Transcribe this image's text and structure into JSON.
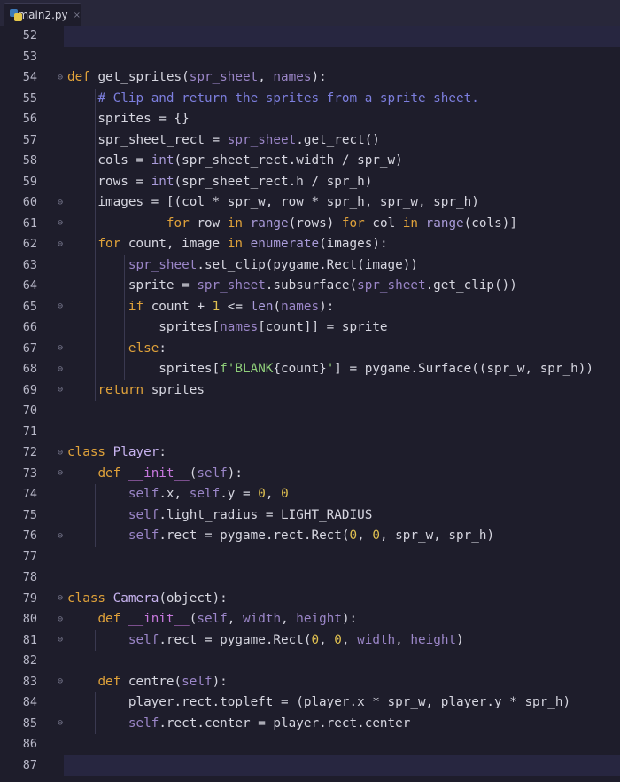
{
  "tab": {
    "filename": "main2.py",
    "close": "×"
  },
  "lines": [
    {
      "n": "52",
      "fold": "",
      "segs": []
    },
    {
      "n": "53",
      "fold": "",
      "segs": []
    },
    {
      "n": "54",
      "fold": "⊖",
      "segs": [
        [
          "kw",
          "def "
        ],
        [
          "fn",
          "get_sprites("
        ],
        [
          "pm",
          "spr_sheet"
        ],
        [
          "fn",
          ", "
        ],
        [
          "pm",
          "names"
        ],
        [
          "fn",
          "):"
        ]
      ]
    },
    {
      "n": "55",
      "fold": "",
      "segs": [
        [
          "fn",
          "    "
        ],
        [
          "cm",
          "# Clip and return the sprites from a sprite sheet."
        ]
      ]
    },
    {
      "n": "56",
      "fold": "",
      "segs": [
        [
          "fn",
          "    sprites = {}"
        ]
      ]
    },
    {
      "n": "57",
      "fold": "",
      "segs": [
        [
          "fn",
          "    spr_sheet_rect = "
        ],
        [
          "pm",
          "spr_sheet"
        ],
        [
          "fn",
          ".get_rect()"
        ]
      ]
    },
    {
      "n": "58",
      "fold": "",
      "segs": [
        [
          "fn",
          "    cols = "
        ],
        [
          "bi",
          "int"
        ],
        [
          "fn",
          "(spr_sheet_rect.width / spr_w)"
        ]
      ]
    },
    {
      "n": "59",
      "fold": "",
      "segs": [
        [
          "fn",
          "    rows = "
        ],
        [
          "bi",
          "int"
        ],
        [
          "fn",
          "(spr_sheet_rect.h / spr_h)"
        ]
      ]
    },
    {
      "n": "60",
      "fold": "⊖",
      "segs": [
        [
          "fn",
          "    images = [(col * spr_w, row * spr_h, spr_w, spr_h)"
        ]
      ]
    },
    {
      "n": "61",
      "fold": "⊖",
      "segs": [
        [
          "fn",
          "             "
        ],
        [
          "kw",
          "for "
        ],
        [
          "fn",
          "row "
        ],
        [
          "kw",
          "in "
        ],
        [
          "bi",
          "range"
        ],
        [
          "fn",
          "(rows) "
        ],
        [
          "kw",
          "for "
        ],
        [
          "fn",
          "col "
        ],
        [
          "kw",
          "in "
        ],
        [
          "bi",
          "range"
        ],
        [
          "fn",
          "(cols)]"
        ]
      ]
    },
    {
      "n": "62",
      "fold": "⊖",
      "segs": [
        [
          "fn",
          "    "
        ],
        [
          "kw",
          "for "
        ],
        [
          "fn",
          "count, image "
        ],
        [
          "kw",
          "in "
        ],
        [
          "bi",
          "enumerate"
        ],
        [
          "fn",
          "(images):"
        ]
      ]
    },
    {
      "n": "63",
      "fold": "",
      "segs": [
        [
          "fn",
          "        "
        ],
        [
          "pm",
          "spr_sheet"
        ],
        [
          "fn",
          ".set_clip(pygame.Rect(image))"
        ]
      ]
    },
    {
      "n": "64",
      "fold": "",
      "segs": [
        [
          "fn",
          "        sprite = "
        ],
        [
          "pm",
          "spr_sheet"
        ],
        [
          "fn",
          ".subsurface("
        ],
        [
          "pm",
          "spr_sheet"
        ],
        [
          "fn",
          ".get_clip())"
        ]
      ]
    },
    {
      "n": "65",
      "fold": "⊖",
      "segs": [
        [
          "fn",
          "        "
        ],
        [
          "kw",
          "if "
        ],
        [
          "fn",
          "count + "
        ],
        [
          "num",
          "1"
        ],
        [
          "fn",
          " <= "
        ],
        [
          "bi",
          "len"
        ],
        [
          "fn",
          "("
        ],
        [
          "pm",
          "names"
        ],
        [
          "fn",
          "):"
        ]
      ]
    },
    {
      "n": "66",
      "fold": "",
      "segs": [
        [
          "fn",
          "            sprites["
        ],
        [
          "pm",
          "names"
        ],
        [
          "fn",
          "[count]] = sprite"
        ]
      ]
    },
    {
      "n": "67",
      "fold": "⊖",
      "segs": [
        [
          "fn",
          "        "
        ],
        [
          "kw",
          "else"
        ],
        [
          "fn",
          ":"
        ]
      ]
    },
    {
      "n": "68",
      "fold": "⊖",
      "segs": [
        [
          "fn",
          "            sprites["
        ],
        [
          "str",
          "f'BLANK"
        ],
        [
          "fn",
          "{count}"
        ],
        [
          "str",
          "'"
        ],
        [
          "fn",
          "] = pygame.Surface((spr_w, spr_h))"
        ]
      ]
    },
    {
      "n": "69",
      "fold": "⊖",
      "segs": [
        [
          "fn",
          "    "
        ],
        [
          "kw",
          "return "
        ],
        [
          "fn",
          "sprites"
        ]
      ]
    },
    {
      "n": "70",
      "fold": "",
      "segs": []
    },
    {
      "n": "71",
      "fold": "",
      "segs": []
    },
    {
      "n": "72",
      "fold": "⊖",
      "segs": [
        [
          "kw",
          "class "
        ],
        [
          "cls",
          "Player"
        ],
        [
          "fn",
          ":"
        ]
      ]
    },
    {
      "n": "73",
      "fold": "⊖",
      "segs": [
        [
          "fn",
          "    "
        ],
        [
          "kw",
          "def "
        ],
        [
          "dn",
          "__init__"
        ],
        [
          "fn",
          "("
        ],
        [
          "sf",
          "self"
        ],
        [
          "fn",
          "):"
        ]
      ]
    },
    {
      "n": "74",
      "fold": "",
      "segs": [
        [
          "fn",
          "        "
        ],
        [
          "sf",
          "self"
        ],
        [
          "fn",
          ".x, "
        ],
        [
          "sf",
          "self"
        ],
        [
          "fn",
          ".y = "
        ],
        [
          "num",
          "0"
        ],
        [
          "fn",
          ", "
        ],
        [
          "num",
          "0"
        ]
      ]
    },
    {
      "n": "75",
      "fold": "",
      "segs": [
        [
          "fn",
          "        "
        ],
        [
          "sf",
          "self"
        ],
        [
          "fn",
          ".light_radius = LIGHT_RADIUS"
        ]
      ]
    },
    {
      "n": "76",
      "fold": "⊖",
      "segs": [
        [
          "fn",
          "        "
        ],
        [
          "sf",
          "self"
        ],
        [
          "fn",
          ".rect = pygame.rect.Rect("
        ],
        [
          "num",
          "0"
        ],
        [
          "fn",
          ", "
        ],
        [
          "num",
          "0"
        ],
        [
          "fn",
          ", spr_w, spr_h)"
        ]
      ]
    },
    {
      "n": "77",
      "fold": "",
      "segs": []
    },
    {
      "n": "78",
      "fold": "",
      "segs": []
    },
    {
      "n": "79",
      "fold": "⊖",
      "segs": [
        [
          "kw",
          "class "
        ],
        [
          "cls",
          "Camera"
        ],
        [
          "fn",
          "(object):"
        ]
      ]
    },
    {
      "n": "80",
      "fold": "⊖",
      "segs": [
        [
          "fn",
          "    "
        ],
        [
          "kw",
          "def "
        ],
        [
          "dn",
          "__init__"
        ],
        [
          "fn",
          "("
        ],
        [
          "sf",
          "self"
        ],
        [
          "fn",
          ", "
        ],
        [
          "pm",
          "width"
        ],
        [
          "fn",
          ", "
        ],
        [
          "pm",
          "height"
        ],
        [
          "fn",
          "):"
        ]
      ]
    },
    {
      "n": "81",
      "fold": "⊖",
      "segs": [
        [
          "fn",
          "        "
        ],
        [
          "sf",
          "self"
        ],
        [
          "fn",
          ".rect = pygame.Rect("
        ],
        [
          "num",
          "0"
        ],
        [
          "fn",
          ", "
        ],
        [
          "num",
          "0"
        ],
        [
          "fn",
          ", "
        ],
        [
          "pm",
          "width"
        ],
        [
          "fn",
          ", "
        ],
        [
          "pm",
          "height"
        ],
        [
          "fn",
          ")"
        ]
      ]
    },
    {
      "n": "82",
      "fold": "",
      "segs": []
    },
    {
      "n": "83",
      "fold": "⊖",
      "segs": [
        [
          "fn",
          "    "
        ],
        [
          "kw",
          "def "
        ],
        [
          "fn",
          "centre("
        ],
        [
          "sf",
          "self"
        ],
        [
          "fn",
          "):"
        ]
      ]
    },
    {
      "n": "84",
      "fold": "",
      "segs": [
        [
          "fn",
          "        player.rect.topleft = (player.x * spr_w, player.y * spr_h)"
        ]
      ]
    },
    {
      "n": "85",
      "fold": "⊖",
      "segs": [
        [
          "fn",
          "        "
        ],
        [
          "sf",
          "self"
        ],
        [
          "fn",
          ".rect.center = player.rect.center"
        ]
      ]
    },
    {
      "n": "86",
      "fold": "",
      "segs": []
    },
    {
      "n": "87",
      "fold": "",
      "segs": []
    }
  ]
}
